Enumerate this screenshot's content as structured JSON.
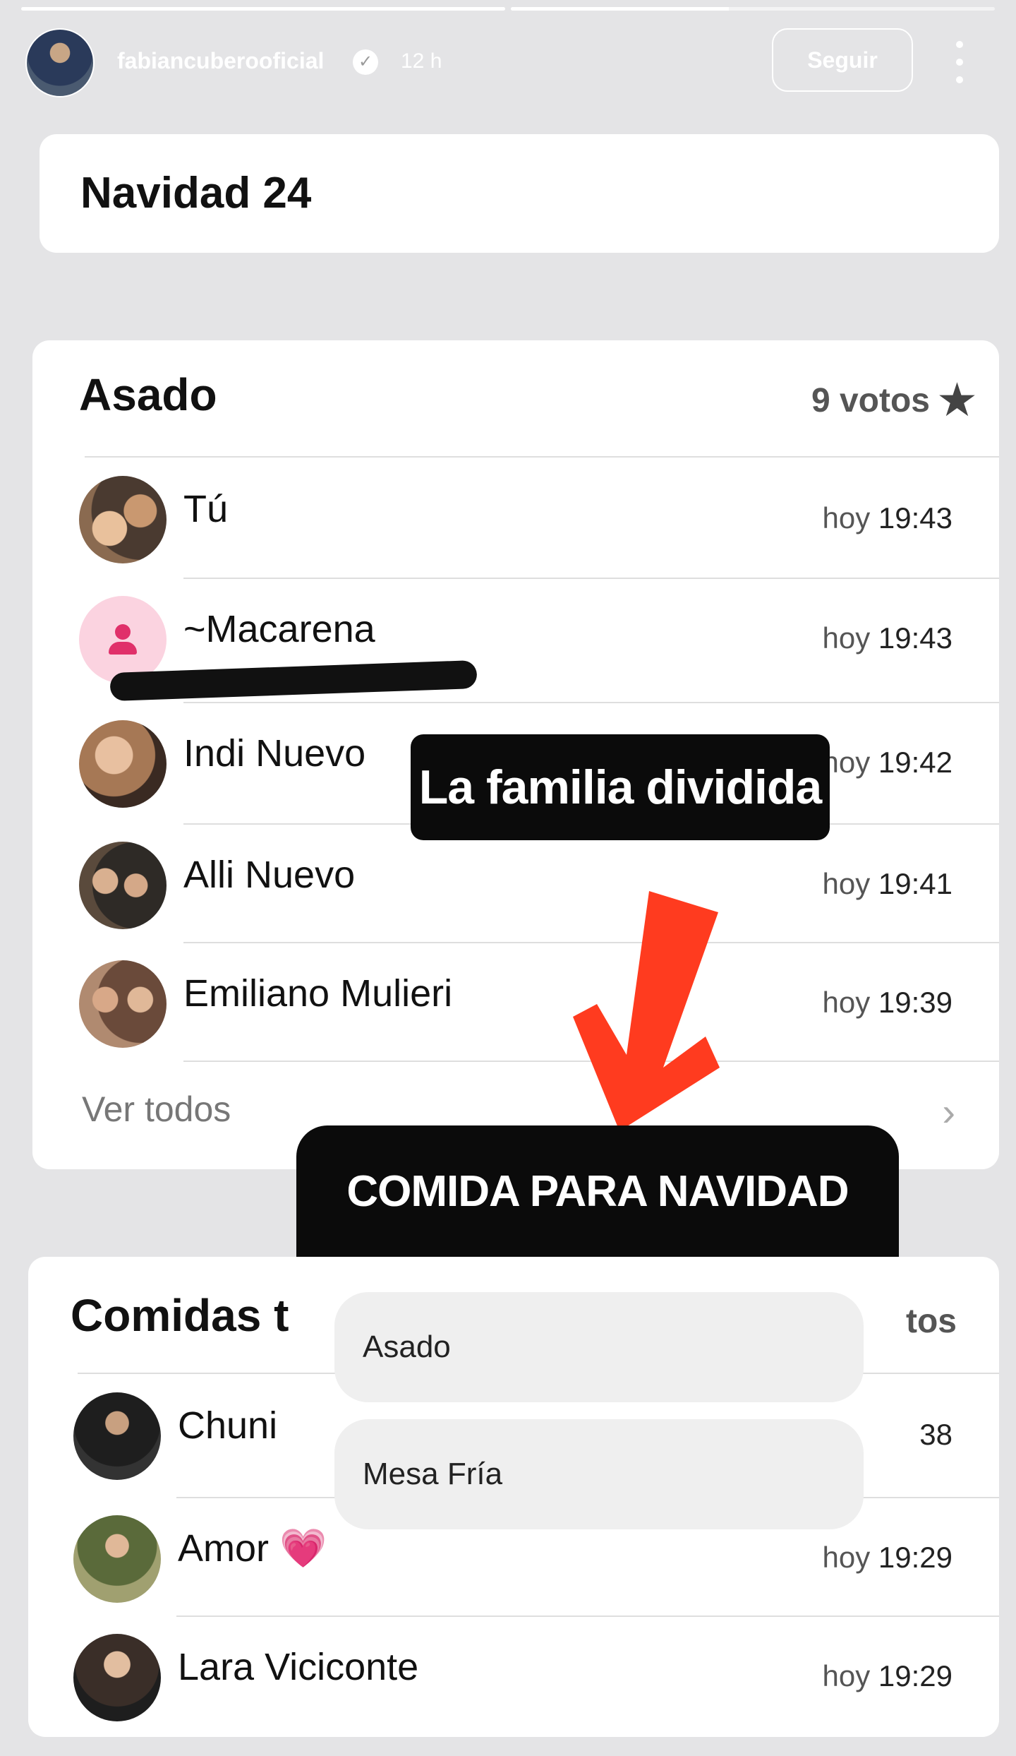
{
  "story": {
    "progress": [
      1.0,
      0.45
    ],
    "username": "fabiancuberooficial",
    "time_ago": "12 h",
    "follow_label": "Seguir",
    "verified_icon": "verified-badge-icon"
  },
  "title_card": {
    "text": "Navidad 24"
  },
  "poll1": {
    "title": "Asado",
    "votes": "9 votos",
    "voters": [
      {
        "name": "Tú",
        "hoy": "hoy",
        "time": "19:43"
      },
      {
        "name": "~Macarena",
        "hoy": "hoy",
        "time": "19:43"
      },
      {
        "name": "Indi Nuevo",
        "hoy": "hoy",
        "time": "19:42"
      },
      {
        "name": "Alli  Nuevo",
        "hoy": "hoy",
        "time": "19:41"
      },
      {
        "name": "Emiliano Mulieri",
        "hoy": "hoy",
        "time": "19:39"
      }
    ],
    "see_all": "Ver todos"
  },
  "poll2": {
    "title": "Comidas t",
    "votes": "tos",
    "voters": [
      {
        "name": "Chuni",
        "hoy": "",
        "time": "38"
      },
      {
        "name": "Amor 💗",
        "hoy": "hoy",
        "time": "19:29"
      },
      {
        "name": "Lara Viciconte",
        "hoy": "hoy",
        "time": "19:29"
      }
    ]
  },
  "stickers": {
    "familia": "La familia dividida",
    "comida_title": "COMIDA PARA NAVIDAD",
    "options": [
      "Asado",
      "Mesa Fría"
    ]
  },
  "colors": {
    "arrow": "#ff3b1f",
    "sticker_bg": "#0b0b0b",
    "placeholder_avatar": "#fbd3e0"
  }
}
